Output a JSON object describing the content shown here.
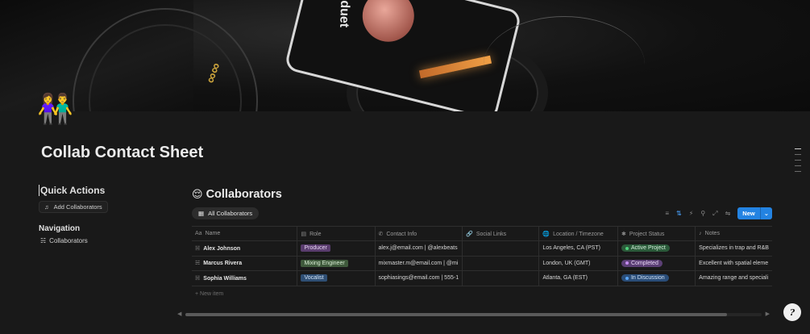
{
  "page": {
    "title": "Collab Contact Sheet",
    "icon": "couple-icon",
    "cover_brand": "duet"
  },
  "left": {
    "quick_actions_heading": "Quick Actions",
    "add_collaborators_label": "Add Collaborators",
    "navigation_heading": "Navigation",
    "nav_items": [
      {
        "label": "Collaborators",
        "icon": "hierarchy-icon"
      }
    ]
  },
  "database": {
    "title": "Collaborators",
    "title_emoji": "😌",
    "view_tab": "All Collaborators",
    "new_button": "New",
    "columns": [
      {
        "label": "Name",
        "icon": "Aa"
      },
      {
        "label": "Role",
        "icon": "select-icon"
      },
      {
        "label": "Contact Info",
        "icon": "phone-icon"
      },
      {
        "label": "Social Links",
        "icon": "link-icon"
      },
      {
        "label": "Location / Timezone",
        "icon": "globe-icon"
      },
      {
        "label": "Project Status",
        "icon": "status-icon"
      },
      {
        "label": "Notes",
        "icon": "music-icon"
      }
    ],
    "rows": [
      {
        "name": "Alex Johnson",
        "role": "Producer",
        "contact": "alex.j@email.com | @alexbeats",
        "social": "",
        "location": "Los Angeles, CA (PST)",
        "status": "Active Project",
        "notes": "Specializes in trap and R&B"
      },
      {
        "name": "Marcus Rivera",
        "role": "Mixing Engineer",
        "contact": "mixmaster.m@email.com | @mi",
        "social": "",
        "location": "London, UK (GMT)",
        "status": "Completed",
        "notes": "Excellent with spatial eleme"
      },
      {
        "name": "Sophia Williams",
        "role": "Vocalist",
        "contact": "sophiasings@email.com | 555-1",
        "social": "",
        "location": "Atlanta, GA (EST)",
        "status": "In Discussion",
        "notes": "Amazing range and speciali"
      }
    ],
    "new_item_label": "New item"
  },
  "colors": {
    "accent": "#2383e2",
    "background": "#191919",
    "status_active": "#4fd07a",
    "status_completed": "#c48bf0",
    "status_discussion": "#5aa4f5"
  }
}
